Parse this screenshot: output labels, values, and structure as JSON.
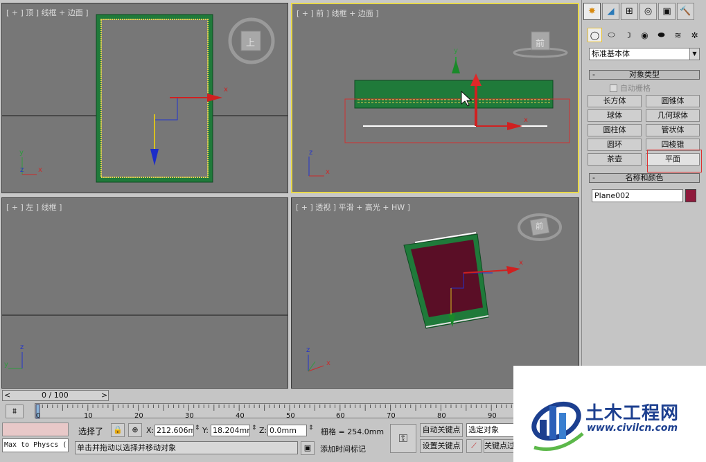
{
  "viewports": {
    "top": {
      "label": "[ + ] 顶 ] 线框 + 边面 ]",
      "cube": "上"
    },
    "front": {
      "label": "[ + ] 前 ] 线框 + 边面 ]",
      "cube": "前"
    },
    "left": {
      "label": "[ + ] 左 ] 线框 ]"
    },
    "persp": {
      "label": "[ + ] 透视 ] 平滑 + 高光 + HW ]",
      "cube": "前"
    },
    "axes": {
      "x": "x",
      "y": "y",
      "z": "z"
    }
  },
  "command_panel": {
    "tabs": [
      "✸",
      "◢",
      "⊞",
      "◎",
      "▣",
      "🔨"
    ],
    "sub_icons": [
      "◯",
      "⬭",
      "☽",
      "◉",
      "⬬",
      "≋",
      "✲"
    ],
    "dropdown": "标准基本体",
    "object_type_title": "对象类型",
    "auto_grid": "自动栅格",
    "buttons": [
      "长方体",
      "圆锥体",
      "球体",
      "几何球体",
      "圆柱体",
      "管状体",
      "圆环",
      "四棱锥",
      "茶壶",
      "平面"
    ],
    "name_color_title": "名称和颜色",
    "object_name": "Plane002",
    "object_color": "#8f1a3c",
    "minus": "-"
  },
  "timeline": {
    "frame": "0 / 100",
    "prev": "<",
    "next": ">",
    "ticks": [
      "0",
      "10",
      "20",
      "30",
      "40",
      "50",
      "60",
      "70",
      "80",
      "90"
    ]
  },
  "status": {
    "maxscript": "Max to Physcs (",
    "selected": "选择了",
    "x_label": "X:",
    "x_value": "212.606mm",
    "y_label": "Y:",
    "y_value": "18.204mm",
    "z_label": "Z:",
    "z_value": "0.0mm",
    "grid": "栅格 = 254.0mm",
    "prompt": "单击并拖动以选择并移动对象",
    "add_time_tag": "添加时间标记",
    "auto_key": "自动关键点",
    "selected_objects": "选定对象",
    "set_key": "设置关键点",
    "key_filter": "关键点过"
  },
  "watermark": {
    "title": "土木工程网",
    "url": "www.civilcn.com"
  }
}
